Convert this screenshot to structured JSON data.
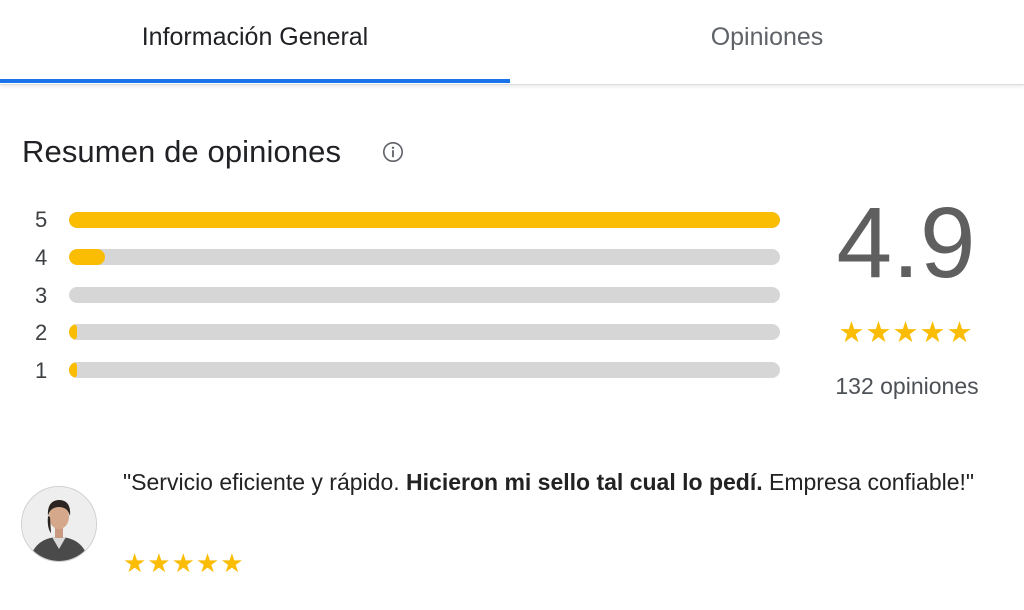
{
  "tabs": [
    {
      "label": "Información General",
      "active": true
    },
    {
      "label": "Opiniones",
      "active": false
    }
  ],
  "summary": {
    "title": "Resumen de opiniones",
    "info_icon": "info-circle-icon",
    "distribution": [
      {
        "stars": "5",
        "fraction": 1.0
      },
      {
        "stars": "4",
        "fraction": 0.05
      },
      {
        "stars": "3",
        "fraction": 0.0
      },
      {
        "stars": "2",
        "fraction": 0.01
      },
      {
        "stars": "1",
        "fraction": 0.01
      }
    ],
    "average": "4.9",
    "stars": "★★★★★",
    "rating_of_5": 5,
    "review_count_label": "132 opiniones"
  },
  "review": {
    "avatar_icon": "user-avatar-photo",
    "text_start": "\"Servicio eficiente y rápido. ",
    "text_bold": "Hicieron mi sello tal cual lo pedí.",
    "text_end": " Empresa confiable!\"",
    "stars": "★★★★★",
    "rating_of_5": 5
  },
  "colors": {
    "accent": "#1a73e8",
    "star": "#fbbc04",
    "track": "#d6d6d6",
    "score_text": "#5f5f5f"
  }
}
